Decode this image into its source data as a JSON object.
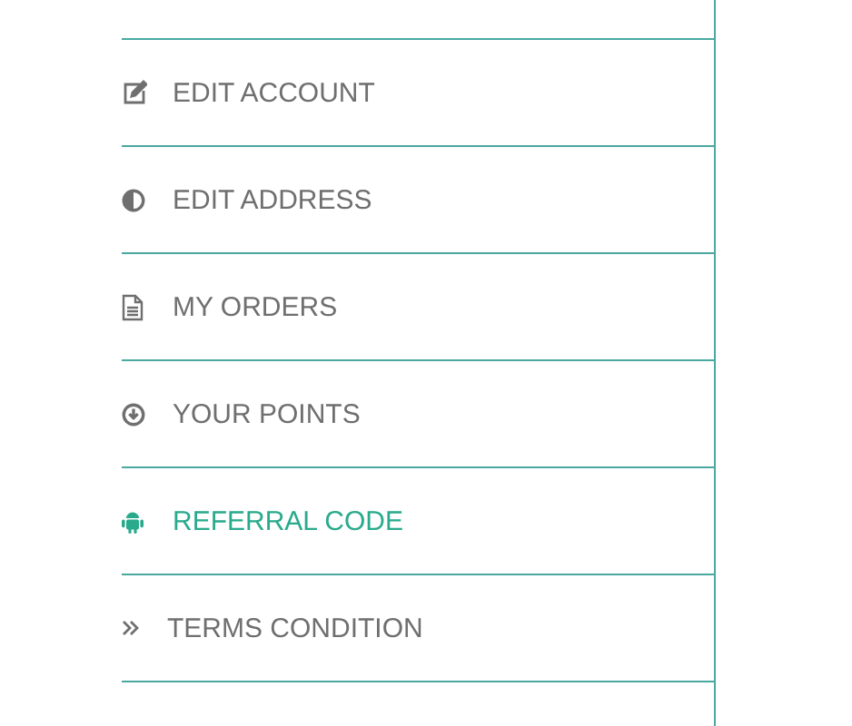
{
  "menu": {
    "items": [
      {
        "label": "EDIT ACCOUNT",
        "selected": false
      },
      {
        "label": "EDIT ADDRESS",
        "selected": false
      },
      {
        "label": "MY ORDERS",
        "selected": false
      },
      {
        "label": "YOUR POINTS",
        "selected": false
      },
      {
        "label": "REFERRAL CODE",
        "selected": true
      },
      {
        "label": "TERMS CONDITION",
        "selected": false
      }
    ]
  }
}
